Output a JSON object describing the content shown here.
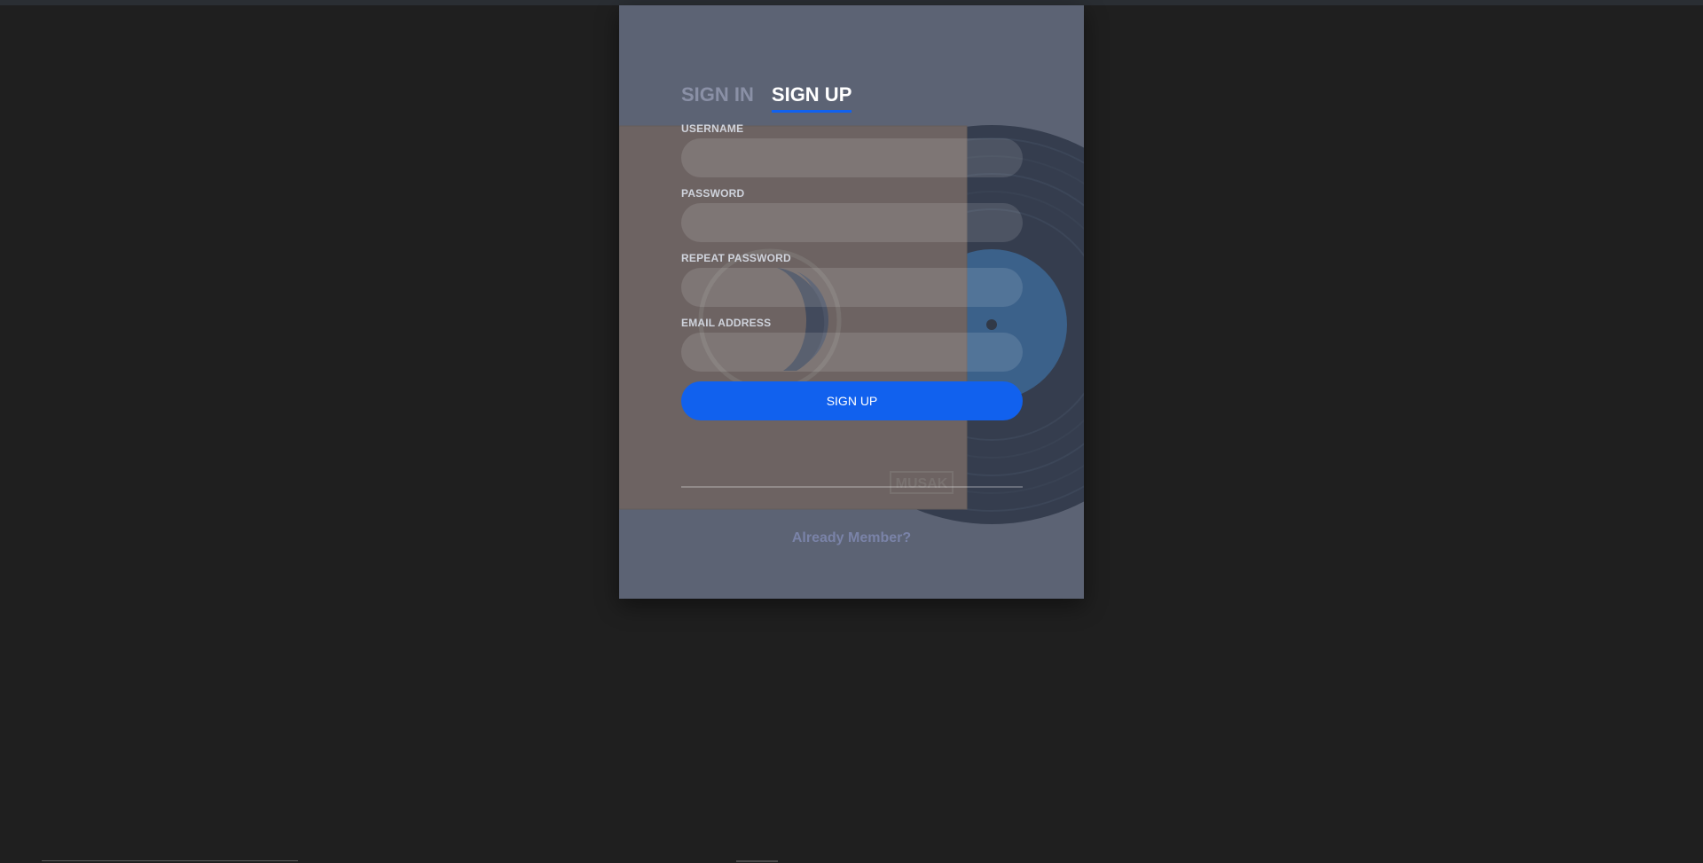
{
  "tabs": {
    "sign_in": "SIGN IN",
    "sign_up": "SIGN UP"
  },
  "form": {
    "username_label": "USERNAME",
    "password_label": "PASSWORD",
    "repeat_password_label": "REPEAT PASSWORD",
    "email_label": "EMAIL ADDRESS",
    "username_value": "",
    "password_value": "",
    "repeat_password_value": "",
    "email_value": "",
    "submit_label": "SIGN UP"
  },
  "footer": {
    "link_text": "Already Member?"
  },
  "background": {
    "sleeve_logo": "MUSAK",
    "colors": {
      "page_bg": "#1f1f1f",
      "card_bg": "#5b6271",
      "sleeve": "#7a6250",
      "vinyl": "#111a2a",
      "vinyl_label": "#1f5d9a",
      "accent": "#1161ee"
    }
  }
}
